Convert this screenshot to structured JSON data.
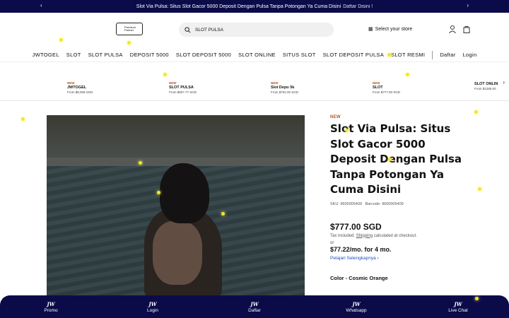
{
  "announcement": {
    "text": "Slot Via Pulsa: Situs Slot Gacor 5000 Deposit Dengan Pulsa Tanpa Potongan Ya Cuma Disini",
    "link": "Daftar Disini !"
  },
  "header": {
    "badge_top": "Premium",
    "badge_bottom": "Partner",
    "search_value": "SLOT PULSA",
    "store_label": "Select your store"
  },
  "nav": {
    "items": [
      "JWTOGEL",
      "SLOT",
      "SLOT PULSA",
      "DEPOSIT 5000",
      "SLOT DEPOSIT 5000",
      "SLOT ONLINE",
      "SITUS SLOT",
      "SLOT DEPOSIT PULSA",
      "SLOT RESMI"
    ],
    "daftar": "Daftar",
    "login": "Login"
  },
  "carousel": [
    {
      "tag": "NEW",
      "name": "JWTOGEL",
      "price": "From $8,009 SGD"
    },
    {
      "tag": "NEW",
      "name": "SLOT PULSA",
      "price": "From $907.77 SGD"
    },
    {
      "tag": "NEW",
      "name": "Slot Depo 5k",
      "price": "From $702.00 SGD"
    },
    {
      "tag": "NEW",
      "name": "SLOT",
      "price": "From $777.00 SGD"
    },
    {
      "tag": "",
      "name": "SLOT ONLIN",
      "price": "From $1285.00"
    }
  ],
  "product": {
    "tag": "NEW",
    "title": "Slot Via Pulsa: Situs Slot Gacor 5000 Deposit Dengan Pulsa Tanpa Potongan Ya Cuma Disini",
    "sku": "SKU: 9600005409",
    "barcode": "Barcode: 9600005409",
    "price": "$777.00 SGD",
    "tax_pre": "Tax included.",
    "tax_link": "Shipping",
    "tax_post": "calculated at checkout.",
    "or": "or",
    "monthly": "$77.22/mo. for 4 mo.",
    "learn_more": "Pelajari Selengkapnya",
    "color_label": "Color - Cosmic Orange"
  },
  "bottom_nav": [
    {
      "logo": "JW",
      "label": "Promo"
    },
    {
      "logo": "JW",
      "label": "Login"
    },
    {
      "logo": "JW",
      "label": "Daftar"
    },
    {
      "logo": "JW",
      "label": "Whatsapp"
    },
    {
      "logo": "JW",
      "label": "Live Chat"
    }
  ],
  "colors": {
    "brand": "#0b0b4a",
    "accent_new": "#b5541b",
    "link": "#2050c0",
    "sparkle": "#f5e624"
  }
}
